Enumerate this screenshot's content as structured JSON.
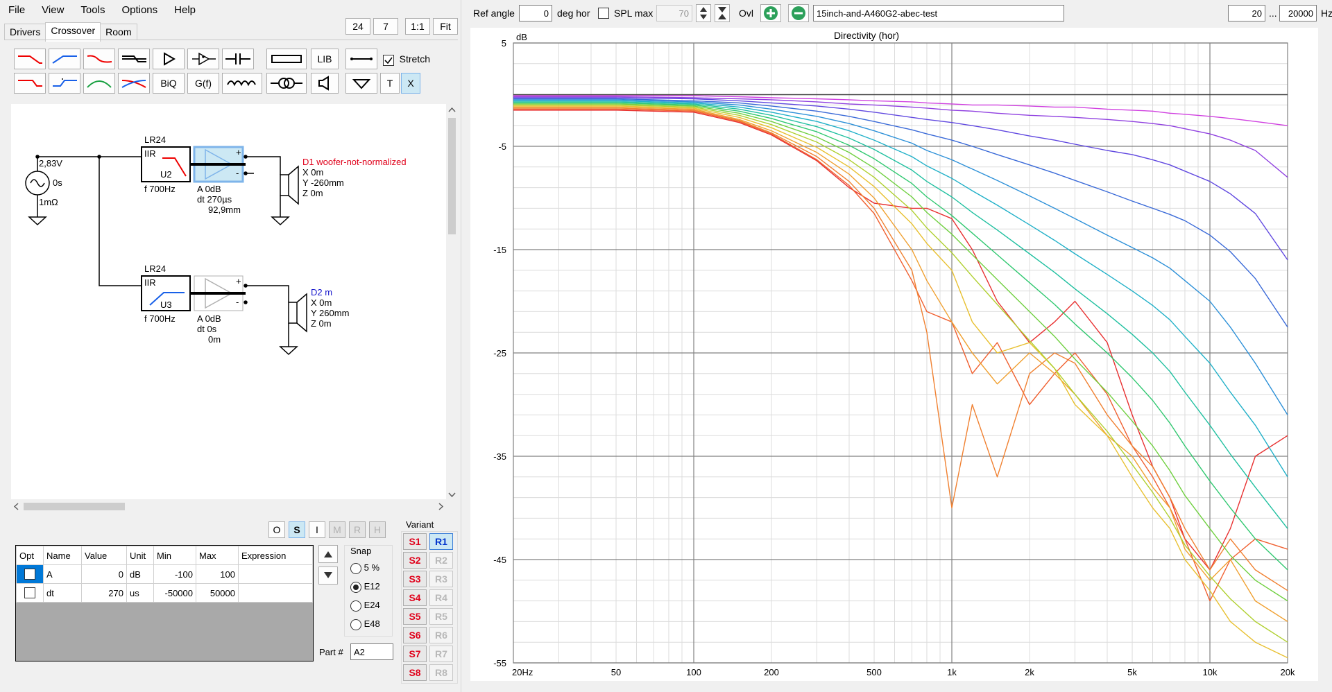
{
  "menu": [
    "File",
    "View",
    "Tools",
    "Options",
    "Help"
  ],
  "tabs": [
    "Drivers",
    "Crossover",
    "Room"
  ],
  "toolbar": {
    "zoom_a": "24",
    "zoom_b": "7",
    "one_to_one": "1:1",
    "fit": "Fit",
    "lib": "LIB",
    "stretch": "Stretch",
    "biq": "BiQ",
    "gf": "G(f)",
    "t": "T",
    "x": "X"
  },
  "schematic": {
    "source": {
      "voltage": "2,83V",
      "delay": "0s",
      "resistance": "1mΩ"
    },
    "branch1": {
      "filter_type": "LR24",
      "filter_label": "IIR",
      "filter_id": "U2",
      "filter_freq": "f   700Hz",
      "amp_a": "A   0dB",
      "amp_dt": "dt 270µs",
      "amp_dist": "92,9mm",
      "driver_name": "D1 woofer-not-normalized",
      "driver_x": "X 0m",
      "driver_y": "Y -260mm",
      "driver_z": "Z 0m",
      "plus": "+",
      "minus": "-"
    },
    "branch2": {
      "filter_type": "LR24",
      "filter_label": "IIR",
      "filter_id": "U3",
      "filter_freq": "f   700Hz",
      "amp_a": "A   0dB",
      "amp_dt": "dt 0s",
      "amp_dist": "0m",
      "driver_name": "D2 m",
      "driver_x": "X 0m",
      "driver_y": "Y 260mm",
      "driver_z": "Z 0m",
      "plus": "+",
      "minus": "-"
    }
  },
  "view_buttons": [
    "O",
    "S",
    "I",
    "M",
    "R",
    "H"
  ],
  "param_table": {
    "headers": [
      "Opt",
      "Name",
      "Value",
      "Unit",
      "Min",
      "Max",
      "Expression"
    ],
    "rows": [
      {
        "name": "A",
        "value": "0",
        "unit": "dB",
        "min": "-100",
        "max": "100",
        "expr": ""
      },
      {
        "name": "dt",
        "value": "270",
        "unit": "us",
        "min": "-50000",
        "max": "50000",
        "expr": ""
      }
    ]
  },
  "snap": {
    "label": "Snap",
    "options": [
      "5 %",
      "E12",
      "E24",
      "E48"
    ],
    "selected": "E12"
  },
  "part": {
    "label": "Part #",
    "value": "A2"
  },
  "variant": {
    "label": "Variant",
    "s": [
      "S1",
      "S2",
      "S3",
      "S4",
      "S5",
      "S6",
      "S7",
      "S8"
    ],
    "r": [
      "R1",
      "R2",
      "R3",
      "R4",
      "R5",
      "R6",
      "R7",
      "R8"
    ],
    "active_r": "R1"
  },
  "topbar": {
    "ref_angle_label": "Ref angle",
    "ref_angle_value": "0",
    "deg_hor": "deg hor",
    "spl_max_label": "SPL max",
    "spl_max_value": "70",
    "ovl": "Ovl",
    "project": "15inch-and-A460G2-abec-test",
    "freq_min": "20",
    "ellipsis": "...",
    "freq_max": "20000",
    "hz": "Hz"
  },
  "colors": {
    "accent": "#cce8f4",
    "red": "#e0001a",
    "blue": "#1515cc",
    "green_btn": "#2ca05a"
  },
  "chart_data": {
    "type": "line",
    "title": "Directivity (hor)",
    "ylabel": "dB",
    "xscale": "log",
    "xlim": [
      20,
      20000
    ],
    "ylim": [
      -55,
      5
    ],
    "yticks": [
      5,
      -5,
      -15,
      -25,
      -35,
      -45,
      -55
    ],
    "xtick_labels": [
      {
        "f": 20,
        "l": "20Hz"
      },
      {
        "f": 50,
        "l": "50"
      },
      {
        "f": 100,
        "l": "100"
      },
      {
        "f": 200,
        "l": "200"
      },
      {
        "f": 500,
        "l": "500"
      },
      {
        "f": 1000,
        "l": "1k"
      },
      {
        "f": 2000,
        "l": "2k"
      },
      {
        "f": 5000,
        "l": "5k"
      },
      {
        "f": 10000,
        "l": "10k"
      },
      {
        "f": 20000,
        "l": "20k"
      }
    ],
    "grid": true,
    "x": [
      20,
      50,
      100,
      150,
      200,
      300,
      400,
      500,
      700,
      800,
      1000,
      1200,
      1500,
      2000,
      2500,
      3000,
      4000,
      5000,
      6000,
      7000,
      8000,
      10000,
      12000,
      15000,
      20000
    ],
    "series": [
      {
        "color": "#404040",
        "values": [
          0,
          0,
          0,
          0,
          0,
          0,
          0,
          0,
          0,
          0,
          0,
          0,
          0,
          0,
          0,
          0,
          0,
          0,
          0,
          0,
          0,
          0,
          0,
          0,
          0
        ]
      },
      {
        "color": "#d040e0",
        "values": [
          -0.1,
          -0.1,
          -0.1,
          -0.2,
          -0.3,
          -0.4,
          -0.5,
          -0.6,
          -0.7,
          -0.8,
          -0.9,
          -1,
          -1,
          -1.1,
          -1.2,
          -1.2,
          -1.4,
          -1.5,
          -1.6,
          -1.8,
          -1.9,
          -2.1,
          -2.3,
          -2.6,
          -3
        ]
      },
      {
        "color": "#9040e0",
        "values": [
          -0.2,
          -0.2,
          -0.3,
          -0.4,
          -0.5,
          -0.7,
          -0.9,
          -1,
          -1.2,
          -1.3,
          -1.5,
          -1.6,
          -1.8,
          -2,
          -2.1,
          -2.2,
          -2.4,
          -2.6,
          -2.8,
          -3,
          -3.3,
          -3.8,
          -4.4,
          -5.4,
          -8
        ]
      },
      {
        "color": "#6048e0",
        "values": [
          -0.3,
          -0.3,
          -0.4,
          -0.6,
          -0.8,
          -1.1,
          -1.4,
          -1.7,
          -2.2,
          -2.4,
          -2.7,
          -3,
          -3.4,
          -4,
          -4.4,
          -4.8,
          -5.4,
          -5.8,
          -6.3,
          -6.8,
          -7.4,
          -8.4,
          -9.6,
          -11.5,
          -16
        ]
      },
      {
        "color": "#3a6ad8",
        "values": [
          -0.4,
          -0.4,
          -0.6,
          -0.8,
          -1.1,
          -1.6,
          -2.1,
          -2.6,
          -3.4,
          -3.8,
          -4.4,
          -5,
          -5.8,
          -6.8,
          -7.6,
          -8.3,
          -9.4,
          -10.3,
          -11,
          -11.6,
          -12.2,
          -13.6,
          -15.2,
          -17.8,
          -22.5
        ]
      },
      {
        "color": "#2c90d8",
        "values": [
          -0.5,
          -0.5,
          -0.7,
          -1,
          -1.4,
          -2.1,
          -2.8,
          -3.5,
          -4.7,
          -5.4,
          -6.3,
          -7.2,
          -8.3,
          -9.8,
          -11,
          -12,
          -13.6,
          -14.8,
          -15.8,
          -16.8,
          -18,
          -20,
          -22.5,
          -26,
          -31
        ]
      },
      {
        "color": "#20b0c8",
        "values": [
          -0.6,
          -0.6,
          -0.8,
          -1.2,
          -1.7,
          -2.6,
          -3.5,
          -4.4,
          -6,
          -6.9,
          -8.1,
          -9.3,
          -10.7,
          -12.6,
          -14.1,
          -15.4,
          -17.4,
          -19,
          -20.4,
          -21.8,
          -23.4,
          -26,
          -28.8,
          -32,
          -37
        ]
      },
      {
        "color": "#20c0a0",
        "values": [
          -0.7,
          -0.7,
          -0.9,
          -1.4,
          -2,
          -3.1,
          -4.2,
          -5.3,
          -7.3,
          -8.4,
          -9.9,
          -11.4,
          -13.1,
          -15.4,
          -17.2,
          -18.8,
          -21.2,
          -23.2,
          -25,
          -26.8,
          -28.8,
          -32,
          -34.8,
          -38,
          -42
        ]
      },
      {
        "color": "#30c870",
        "values": [
          -0.8,
          -0.8,
          -1,
          -1.6,
          -2.3,
          -3.6,
          -4.9,
          -6.2,
          -8.6,
          -9.9,
          -11.7,
          -13.4,
          -15.5,
          -18.2,
          -20.3,
          -22.2,
          -25,
          -27.4,
          -29.6,
          -31.8,
          -34,
          -37.4,
          -40,
          -43,
          -46
        ]
      },
      {
        "color": "#70d040",
        "values": [
          -0.9,
          -0.9,
          -1.1,
          -1.8,
          -2.6,
          -4.1,
          -5.6,
          -7.1,
          -9.9,
          -11.4,
          -13.5,
          -15.5,
          -17.9,
          -21,
          -23.4,
          -25.6,
          -28.8,
          -31.6,
          -34,
          -36.4,
          -38.8,
          -42,
          -44.6,
          -47,
          -49
        ]
      },
      {
        "color": "#b0d030",
        "values": [
          -1,
          -1,
          -1.2,
          -2,
          -2.9,
          -4.6,
          -6.3,
          -8,
          -11.2,
          -12.9,
          -15.3,
          -17.6,
          -20.3,
          -23.8,
          -26.5,
          -29,
          -32.6,
          -35.8,
          -38.5,
          -41,
          -43.6,
          -46.6,
          -48.8,
          -51,
          -53
        ]
      },
      {
        "color": "#e8c030",
        "values": [
          -1.1,
          -1.1,
          -1.3,
          -2.2,
          -3.2,
          -5.1,
          -7,
          -8.9,
          -12.5,
          -14.4,
          -17,
          -22,
          -25,
          -24,
          -26.5,
          -30,
          -33,
          -37,
          -40,
          -42,
          -45,
          -48,
          -51,
          -53,
          -54.5
        ]
      },
      {
        "color": "#f0a030",
        "values": [
          -1.2,
          -1.2,
          -1.4,
          -2.4,
          -3.5,
          -5.6,
          -7.7,
          -10,
          -15,
          -18,
          -22,
          -25,
          -28,
          -25,
          -27,
          -29,
          -33,
          -35,
          -38,
          -40,
          -44,
          -47,
          -45,
          -49,
          -51
        ]
      },
      {
        "color": "#f08030",
        "values": [
          -1.3,
          -1.3,
          -1.5,
          -2.5,
          -3.7,
          -6,
          -8.4,
          -11,
          -17,
          -23,
          -40,
          -30,
          -37,
          -27,
          -25,
          -26,
          -31,
          -34,
          -36,
          -39,
          -42,
          -46,
          -43,
          -46,
          -48
        ]
      },
      {
        "color": "#f06030",
        "values": [
          -1.4,
          -1.4,
          -1.6,
          -2.6,
          -3.8,
          -6.3,
          -8.8,
          -11.5,
          -18,
          -21,
          -22,
          -27,
          -24,
          -30,
          -27,
          -25,
          -29,
          -34,
          -37,
          -40,
          -43,
          -49,
          -45,
          -43,
          -44
        ]
      },
      {
        "color": "#e83030",
        "values": [
          -1.5,
          -1.5,
          -1.7,
          -2.7,
          -3.9,
          -6.4,
          -9,
          -10.5,
          -11,
          -11,
          -12,
          -15,
          -20,
          -24,
          -22,
          -20,
          -24,
          -31,
          -36,
          -39,
          -43,
          -46,
          -42,
          -35,
          -33
        ]
      }
    ]
  }
}
